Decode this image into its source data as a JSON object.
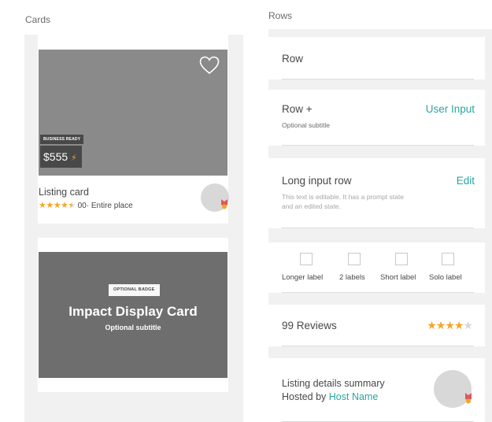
{
  "sections": {
    "cards_title": "Cards",
    "rows_title": "Rows"
  },
  "listing_card": {
    "badge": "BUSINESS READY",
    "price": "$555",
    "bolt_icon": "lightning-bolt-icon",
    "title": "Listing card",
    "rating_stars": 4.5,
    "review_count": "00",
    "separator": "·",
    "room_type": "Entire place",
    "heart_icon": "heart-outline-icon"
  },
  "impact_card": {
    "badge": "OPTIONAL BADGE",
    "title": "Impact Display Card",
    "subtitle": "Optional subtitle"
  },
  "rows": {
    "row": {
      "title": "Row"
    },
    "row_plus": {
      "title": "Row +",
      "subtitle": "Optional subtitle",
      "action": "User Input"
    },
    "long_input": {
      "title": "Long input row",
      "subtitle": "This text is editable. It has a prompt state and an edited state.",
      "action": "Edit"
    },
    "checkboxes": [
      {
        "label": "Longer label"
      },
      {
        "label": "2 labels"
      },
      {
        "label": "Short label"
      },
      {
        "label": "Solo label"
      }
    ],
    "reviews": {
      "title": "99 Reviews",
      "stars_filled": 4,
      "stars_total": 5
    },
    "listing_summary": {
      "title": "Listing details summary",
      "hosted_by": "Hosted by",
      "host_name": "Host Name"
    }
  },
  "colors": {
    "accent_teal": "#2aa59f",
    "star": "#f6a623",
    "panel_bg": "#f1f1f1",
    "photo_light": "#8a8a8a",
    "photo_dark": "#6e6e6e"
  }
}
